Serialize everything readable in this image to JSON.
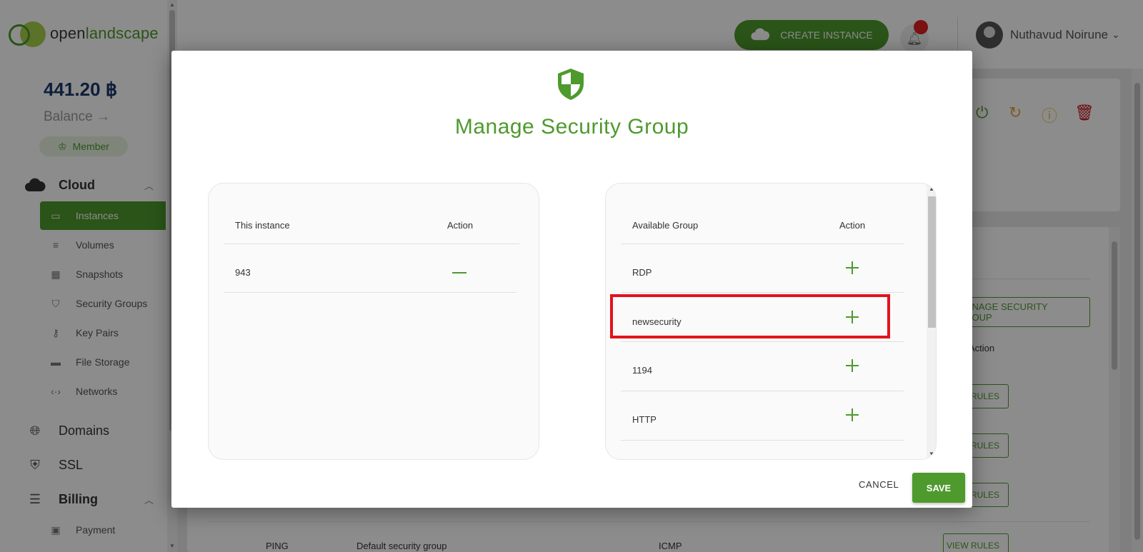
{
  "brand": {
    "name_prefix": "open",
    "name_suffix": "landscape"
  },
  "account": {
    "balance": "441.20 ฿",
    "balance_label": "Balance",
    "member_label": "Member"
  },
  "sidebar": {
    "cloud": {
      "label": "Cloud",
      "items": [
        {
          "label": "Instances",
          "icon": "laptop-icon",
          "active": true
        },
        {
          "label": "Volumes",
          "icon": "volumes-icon"
        },
        {
          "label": "Snapshots",
          "icon": "snapshots-icon"
        },
        {
          "label": "Security Groups",
          "icon": "shield-icon"
        },
        {
          "label": "Key Pairs",
          "icon": "key-icon"
        },
        {
          "label": "File Storage",
          "icon": "folder-icon"
        },
        {
          "label": "Networks",
          "icon": "network-icon"
        }
      ]
    },
    "domains": {
      "label": "Domains"
    },
    "ssl": {
      "label": "SSL"
    },
    "billing": {
      "label": "Billing",
      "items": [
        {
          "label": "Payment",
          "icon": "wallet-icon"
        }
      ]
    }
  },
  "header": {
    "create_instance": "CREATE INSTANCE",
    "user_name": "Nuthavud Noirune"
  },
  "background": {
    "manage_security_group": "MANAGE SECURITY GROUP",
    "action_col": "Action",
    "view_rules": "VIEW RULES",
    "last_row": {
      "name": "PING",
      "description": "Default security group",
      "protocol": "ICMP"
    }
  },
  "modal": {
    "title": "Manage Security Group",
    "left_panel": {
      "col_name": "This instance",
      "col_action": "Action",
      "rows": [
        {
          "name": "943"
        }
      ]
    },
    "right_panel": {
      "col_name": "Available Group",
      "col_action": "Action",
      "rows": [
        {
          "name": "RDP"
        },
        {
          "name": "newsecurity"
        },
        {
          "name": "1194"
        },
        {
          "name": "HTTP"
        }
      ]
    },
    "cancel_label": "CANCEL",
    "save_label": "SAVE"
  },
  "colors": {
    "brand_green": "#4e9a2d",
    "highlight_red": "#e3121c"
  }
}
